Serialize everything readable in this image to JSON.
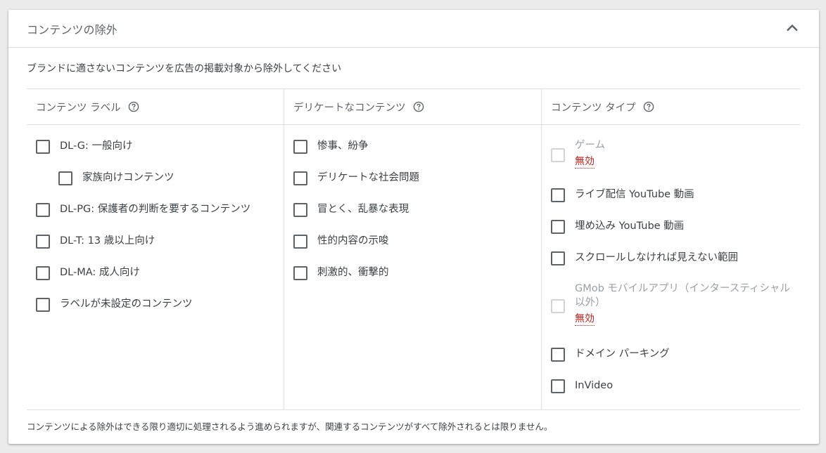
{
  "card": {
    "title": "コンテンツの除外",
    "description": "ブランドに適さないコンテンツを広告の掲載対象から除外してください",
    "footer": "コンテンツによる除外はできる限り適切に処理されるよう進められますが、関連するコンテンツがすべて除外されるとは限りません。"
  },
  "columns": [
    {
      "header": "コンテンツ ラベル",
      "items": [
        {
          "label": "DL-G: 一般向け",
          "checked": false
        },
        {
          "label": "家族向けコンテンツ",
          "checked": false
        },
        {
          "label": "DL-PG: 保護者の判断を要するコンテンツ",
          "checked": false
        },
        {
          "label": "DL-T: 13 歳以上向け",
          "checked": false
        },
        {
          "label": "DL-MA: 成人向け",
          "checked": false
        },
        {
          "label": "ラベルが未設定のコンテンツ",
          "checked": false
        }
      ]
    },
    {
      "header": "デリケートなコンテンツ",
      "items": [
        {
          "label": "惨事、紛争",
          "checked": false
        },
        {
          "label": "デリケートな社会問題",
          "checked": false
        },
        {
          "label": "冒とく、乱暴な表現",
          "checked": false
        },
        {
          "label": "性的内容の示唆",
          "checked": false
        },
        {
          "label": "刺激的、衝撃的",
          "checked": false
        }
      ]
    },
    {
      "header": "コンテンツ タイプ",
      "items": [
        {
          "label": "ゲーム",
          "checked": false,
          "disabled": true,
          "status": "無効"
        },
        {
          "label": "ライブ配信 YouTube 動画",
          "checked": false
        },
        {
          "label": "埋め込み YouTube 動画",
          "checked": false
        },
        {
          "label": "スクロールしなければ見えない範囲",
          "checked": false
        },
        {
          "label": "GMob モバイルアプリ（インタースティシャル以外）",
          "checked": false,
          "disabled": true,
          "status": "無効"
        },
        {
          "label": "ドメイン パーキング",
          "checked": false
        },
        {
          "label": "InVideo",
          "checked": false
        }
      ]
    }
  ],
  "colors": {
    "text": "#3c4043",
    "secondary_text": "#5f6368",
    "disabled_text": "#9aa0a6",
    "error": "#c5221f",
    "divider": "#e0e0e0"
  }
}
